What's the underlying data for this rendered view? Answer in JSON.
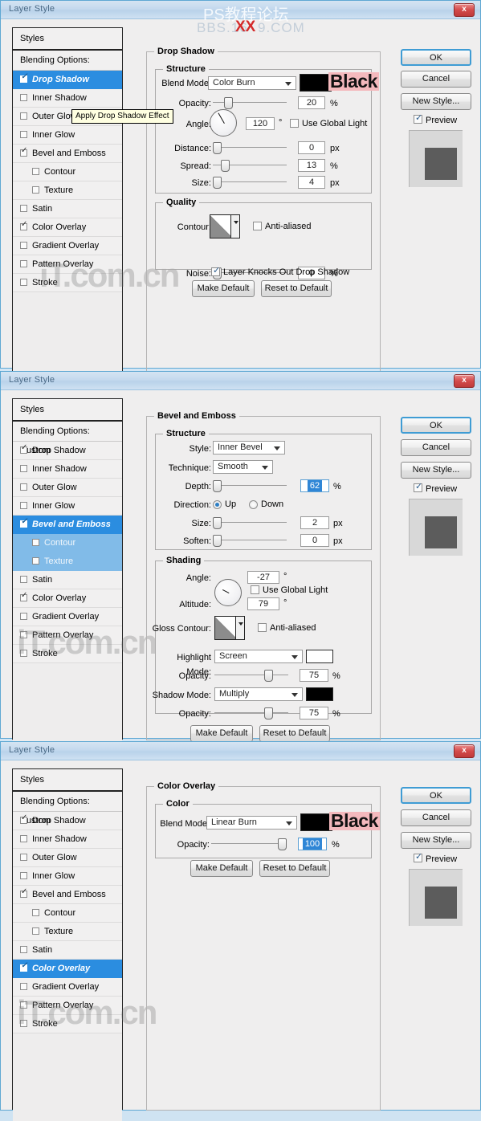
{
  "window": {
    "title": "Layer Style",
    "close_label": "x"
  },
  "watermarks": {
    "top_cn": "PS教程论坛",
    "top_bbs_left": "BBS.16",
    "top_bbs_xx": "XX",
    "top_bbs_right": "9.COM",
    "site": "iT.com.cn"
  },
  "styles_list": {
    "header": "Styles",
    "blending_options": "Blending Options: Custom",
    "items": [
      {
        "label": "Drop Shadow",
        "checked": true,
        "indent": false
      },
      {
        "label": "Inner Shadow",
        "checked": false,
        "indent": false
      },
      {
        "label": "Outer Glow",
        "checked": false,
        "indent": false
      },
      {
        "label": "Inner Glow",
        "checked": false,
        "indent": false
      },
      {
        "label": "Bevel and Emboss",
        "checked": true,
        "indent": false
      },
      {
        "label": "Contour",
        "checked": false,
        "indent": true
      },
      {
        "label": "Texture",
        "checked": false,
        "indent": true
      },
      {
        "label": "Satin",
        "checked": false,
        "indent": false
      },
      {
        "label": "Color Overlay",
        "checked": true,
        "indent": false
      },
      {
        "label": "Gradient Overlay",
        "checked": false,
        "indent": false
      },
      {
        "label": "Pattern Overlay",
        "checked": false,
        "indent": false
      },
      {
        "label": "Stroke",
        "checked": false,
        "indent": false
      }
    ]
  },
  "buttons": {
    "ok": "OK",
    "cancel": "Cancel",
    "new_style": "New Style...",
    "preview": "Preview",
    "make_default": "Make Default",
    "reset_to_default": "Reset to Default"
  },
  "dialog1": {
    "selected_style": "Drop Shadow",
    "tooltip": "Apply Drop Shadow Effect",
    "section_title": "Drop Shadow",
    "structure_legend": "Structure",
    "quality_legend": "Quality",
    "blend_mode_label": "Blend Mode:",
    "blend_mode_value": "Color Burn",
    "color_word": "Black",
    "color_hex": "#000000",
    "opacity_label": "Opacity:",
    "opacity_value": "20",
    "opacity_unit": "%",
    "angle_label": "Angle:",
    "angle_value": "120",
    "angle_unit": "°",
    "use_global_light": "Use Global Light",
    "use_global_light_checked": false,
    "distance_label": "Distance:",
    "distance_value": "0",
    "distance_unit": "px",
    "spread_label": "Spread:",
    "spread_value": "13",
    "spread_unit": "%",
    "size_label": "Size:",
    "size_value": "4",
    "size_unit": "px",
    "contour_label": "Contour:",
    "anti_aliased": "Anti-aliased",
    "anti_aliased_checked": false,
    "noise_label": "Noise:",
    "noise_value": "0",
    "noise_unit": "%",
    "knocks_out": "Layer Knocks Out Drop Shadow",
    "knocks_out_checked": true
  },
  "dialog2": {
    "selected_style": "Bevel and Emboss",
    "section_title": "Bevel and Emboss",
    "structure_legend": "Structure",
    "shading_legend": "Shading",
    "style_label": "Style:",
    "style_value": "Inner Bevel",
    "technique_label": "Technique:",
    "technique_value": "Smooth",
    "depth_label": "Depth:",
    "depth_value": "62",
    "depth_unit": "%",
    "direction_label": "Direction:",
    "direction_up": "Up",
    "direction_down": "Down",
    "direction_selected": "Up",
    "size_label": "Size:",
    "size_value": "2",
    "size_unit": "px",
    "soften_label": "Soften:",
    "soften_value": "0",
    "soften_unit": "px",
    "angle_label": "Angle:",
    "angle_value": "-27",
    "angle_unit": "°",
    "use_global_light": "Use Global Light",
    "use_global_light_checked": false,
    "altitude_label": "Altitude:",
    "altitude_value": "79",
    "altitude_unit": "°",
    "gloss_contour_label": "Gloss Contour:",
    "anti_aliased": "Anti-aliased",
    "anti_aliased_checked": false,
    "highlight_mode_label": "Highlight Mode:",
    "highlight_mode_value": "Screen",
    "highlight_color_hex": "#ffffff",
    "highlight_opacity_label": "Opacity:",
    "highlight_opacity_value": "75",
    "highlight_opacity_unit": "%",
    "shadow_mode_label": "Shadow Mode:",
    "shadow_mode_value": "Multiply",
    "shadow_color_hex": "#000000",
    "shadow_opacity_label": "Opacity:",
    "shadow_opacity_value": "75",
    "shadow_opacity_unit": "%"
  },
  "dialog3": {
    "selected_style": "Color Overlay",
    "section_title": "Color Overlay",
    "color_legend": "Color",
    "blend_mode_label": "Blend Mode:",
    "blend_mode_value": "Linear Burn",
    "color_word": "Black",
    "color_hex": "#000000",
    "opacity_label": "Opacity:",
    "opacity_value": "100",
    "opacity_unit": "%"
  }
}
